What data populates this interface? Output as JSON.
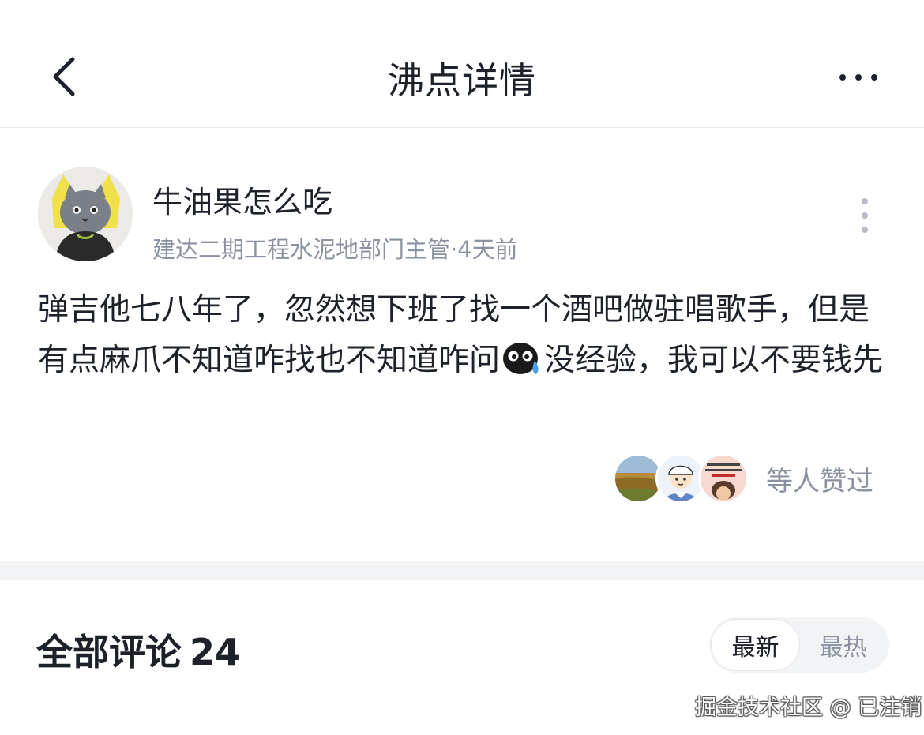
{
  "header": {
    "title": "沸点详情",
    "back_icon": "chevron-left-icon",
    "more_icon": "more-horizontal-icon"
  },
  "post": {
    "author": {
      "name": "牛油果怎么吃",
      "meta": "建达二期工程水泥地部门主管·4天前",
      "avatar": "gray-cat-avatar"
    },
    "menu_icon": "more-vertical-icon",
    "content": {
      "part1": "弹吉他七八年了，忽然想下班了找一个酒吧做驻唱歌手，但是有点麻爪不知道咋找也不知道咋问",
      "emoji": "crying-face-emoji",
      "part2": "没经验，我可以不要钱先"
    },
    "likes": {
      "avatars": [
        "landscape-avatar",
        "cartoon-boy-avatar",
        "meme-text-avatar"
      ],
      "label": "等人赞过"
    }
  },
  "comments": {
    "title": "全部评论",
    "count": "24",
    "sort_options": [
      {
        "label": "最新",
        "active": true
      },
      {
        "label": "最热",
        "active": false
      }
    ]
  },
  "watermark": "掘金技术社区 @ 已注销",
  "colors": {
    "text_primary": "#1d2129",
    "text_secondary": "#8a919f",
    "divider_band": "#f2f3f5"
  }
}
